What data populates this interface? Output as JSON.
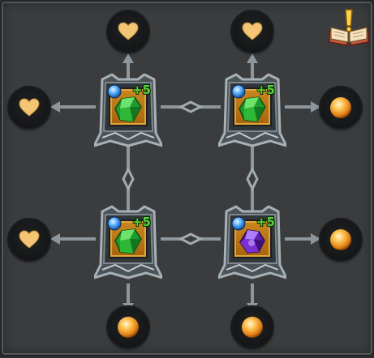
{
  "colors": {
    "board_bg": "#3a3c3e",
    "connector": "#8d969c",
    "slot_gold": "#c9871e",
    "level_text": "#57d13a",
    "heart": "#f3c575",
    "orb": "#f6a22c",
    "gem_green": "#2fae35",
    "gem_purple": "#7a2fd1",
    "socket_blue": "#3d8fe0"
  },
  "grid": {
    "cells": [
      {
        "row": 1,
        "col": 1,
        "gem": "green-emerald-gem",
        "socket": "blue-socket-orb",
        "level": "+5"
      },
      {
        "row": 1,
        "col": 2,
        "gem": "green-emerald-gem",
        "socket": "blue-socket-orb",
        "level": "+5"
      },
      {
        "row": 2,
        "col": 1,
        "gem": "green-emerald-gem",
        "socket": "blue-socket-orb",
        "level": "+5"
      },
      {
        "row": 2,
        "col": 2,
        "gem": "purple-amethyst-gem",
        "socket": "blue-socket-orb",
        "level": "+5"
      }
    ],
    "outer_nodes": {
      "top": [
        "heart-icon",
        "heart-icon"
      ],
      "left": [
        "heart-icon",
        "heart-icon"
      ],
      "right": [
        "orb-icon",
        "orb-icon"
      ],
      "bottom": [
        "orb-icon",
        "orb-icon"
      ]
    }
  },
  "corner_button": {
    "icon": "quest-book-icon"
  }
}
